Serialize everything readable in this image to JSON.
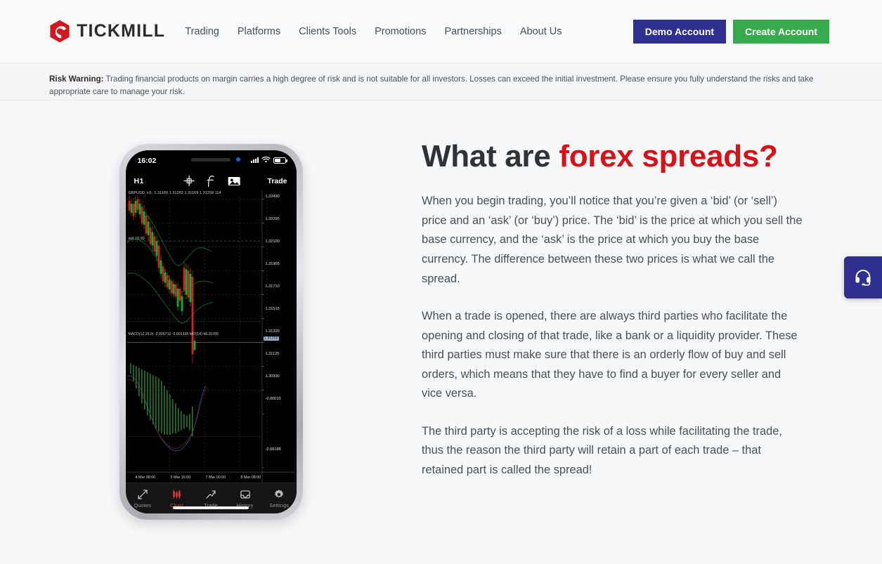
{
  "header": {
    "logo_text": "TICKMILL",
    "logo_icon": "tickmill-hexagon-logo",
    "nav": [
      {
        "label": "Trading"
      },
      {
        "label": "Platforms"
      },
      {
        "label": "Clients Tools"
      },
      {
        "label": "Promotions"
      },
      {
        "label": "Partnerships"
      },
      {
        "label": "About Us"
      }
    ],
    "demo_button": "Demo Account",
    "create_button": "Create Account",
    "demo_button_color": "#2f2f8f",
    "create_button_color": "#37ab4b"
  },
  "risk_warning": {
    "label": "Risk Warning:",
    "text": " Trading financial products on margin carries a high degree of risk and is not suitable for all investors. Losses can exceed the initial investment. Please ensure you fully understand the risks and take appropriate care to manage your risk."
  },
  "article": {
    "heading_plain": "What are ",
    "heading_accent": "forex spreads?",
    "accent_color": "#d81118",
    "paragraphs": [
      "When you begin trading, you’ll notice that you’re given a ‘bid’ (or ‘sell’) price and an ‘ask’ (or ‘buy’) price. The ‘bid’ is the price at which you sell the base currency, and the ‘ask’ is the price at which you buy the base currency. The difference between these two prices is what we call the spread.",
      "When a trade is opened, there are always third parties who facilitate the opening and closing of that trade, like a bank or a liquidity provider. These third parties must make sure that there is an orderly flow of buy and sell orders, which means that they have to find a buyer for every seller and vice versa.",
      "The third party is accepting the risk of a loss while facilitating the trade, thus the reason the third party will retain a part of each trade – that retained part is called the spread!"
    ]
  },
  "phone": {
    "status": {
      "time": "16:02",
      "signal_icon": "signal-bars-icon",
      "wifi_icon": "wifi-icon",
      "battery_icon": "battery-icon"
    },
    "toolbar": {
      "timeframe": "H1",
      "crosshair_icon": "crosshair-icon",
      "indicators_icon": "function-indicator-icon",
      "objects_icon": "objects-icon",
      "trade_label": "Trade"
    },
    "chart": {
      "symbol_line": "GBPUSD, H1, 1.31189 1.31282 1.31169 1.31258 114",
      "indicator_line": "MACD(12,26,9) -0.000710 -0.001338 MFI(14) 48.25789",
      "sell_label": "sell 10.00",
      "current_price": "1.31255",
      "price_labels": [
        "1.32490",
        "1.32295",
        "1.32100",
        "1.31905",
        "1.31710",
        "1.31515",
        "1.31320",
        "1.31125",
        "1.30930"
      ],
      "sub_labels": [
        "-0.00010",
        "-0.00188"
      ],
      "time_labels": [
        "4 Mar 08:00",
        "5 Mar 16:00",
        "7 Mar 00:00",
        "8 Mar 08:00"
      ],
      "bull_color": "#00b33c",
      "bear_color": "#e01d1d"
    },
    "tabs": [
      {
        "label": "Quotes",
        "icon": "quotes-arrows-icon",
        "active": false
      },
      {
        "label": "Chart",
        "icon": "candlestick-icon",
        "active": true
      },
      {
        "label": "Trade",
        "icon": "trend-arrow-icon",
        "active": false
      },
      {
        "label": "History",
        "icon": "inbox-icon",
        "active": false
      },
      {
        "label": "Settings",
        "icon": "gear-icon",
        "active": false
      }
    ]
  },
  "support_fab": {
    "icon": "headset-support-icon",
    "color": "#2f2f8f"
  }
}
